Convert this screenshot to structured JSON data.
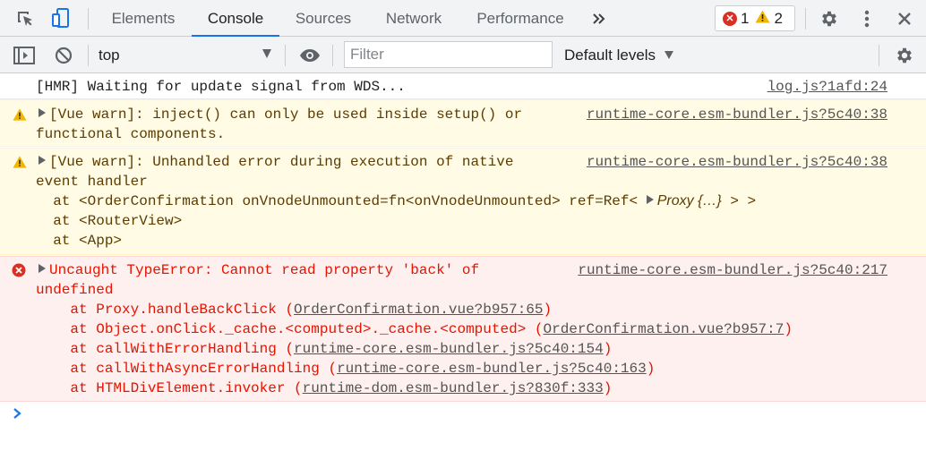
{
  "tabs": [
    {
      "label": "Elements"
    },
    {
      "label": "Console"
    },
    {
      "label": "Sources"
    },
    {
      "label": "Network"
    },
    {
      "label": "Performance"
    }
  ],
  "active_tab": "Console",
  "counts": {
    "errors": "1",
    "warnings": "2"
  },
  "toolbar": {
    "context": "top",
    "filter_placeholder": "Filter",
    "filter_value": "",
    "levels": "Default levels"
  },
  "messages": {
    "m1": {
      "text": "[HMR] Waiting for update signal from WDS...",
      "source": "log.js?1afd:24"
    },
    "m2": {
      "line1": "[Vue warn]: inject() can only be used inside setup() or",
      "line2": "functional components.",
      "source": "runtime-core.esm-bundler.js?5c40:38"
    },
    "m3": {
      "line1": "[Vue warn]: Unhandled error during execution of native",
      "line2": "event handler",
      "at1_pre": "  at <OrderConfirmation onVnodeUnmounted=fn<onVnodeUnmounted> ref=Ref< ",
      "at1_proxy": "Proxy {…}",
      "at1_post": " > >",
      "at2": "  at <RouterView>",
      "at3": "  at <App>",
      "source": "runtime-core.esm-bundler.js?5c40:38"
    },
    "m4": {
      "line1": "Uncaught TypeError: Cannot read property 'back' of",
      "line2": "undefined",
      "source": "runtime-core.esm-bundler.js?5c40:217",
      "stack": [
        {
          "fn": "    at Proxy.handleBackClick (",
          "link": "OrderConfirmation.vue?b957:65",
          "end": ")"
        },
        {
          "fn": "    at Object.onClick._cache.<computed>._cache.<computed> (",
          "link": "OrderConfirmation.vue?b957:7",
          "end": ")"
        },
        {
          "fn": "    at callWithErrorHandling (",
          "link": "runtime-core.esm-bundler.js?5c40:154",
          "end": ")"
        },
        {
          "fn": "    at callWithAsyncErrorHandling (",
          "link": "runtime-core.esm-bundler.js?5c40:163",
          "end": ")"
        },
        {
          "fn": "    at HTMLDivElement.invoker (",
          "link": "runtime-dom.esm-bundler.js?830f:333",
          "end": ")"
        }
      ]
    }
  },
  "colors": {
    "accent": "#1a73e8",
    "error": "#e51400",
    "warning_icon": "#f2b600",
    "error_icon": "#d93025"
  }
}
